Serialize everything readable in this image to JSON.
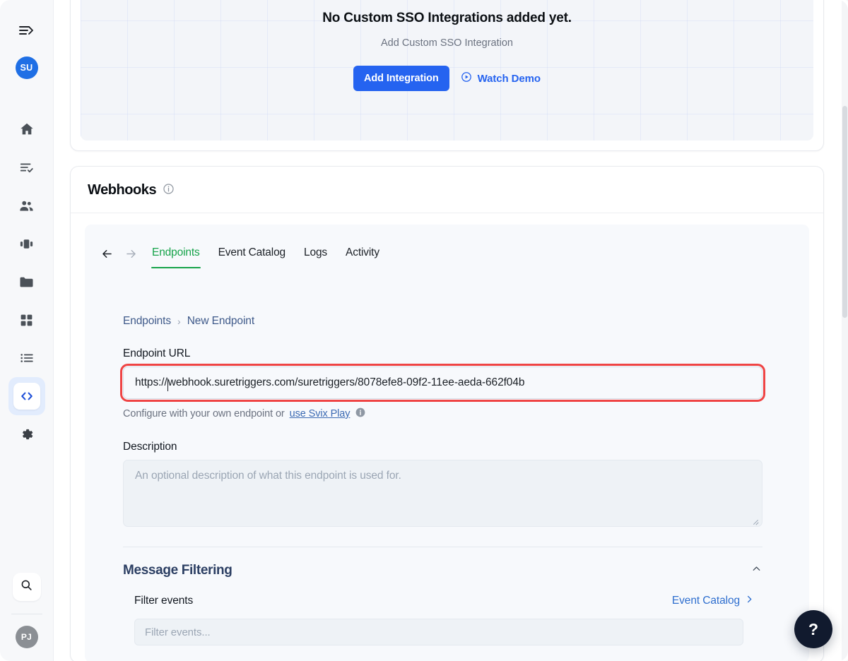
{
  "sidebar": {
    "toggle_label": "Collapse sidebar",
    "workspace_avatar": "SU",
    "user_avatar": "PJ",
    "items": [
      {
        "name": "home",
        "label": "Home"
      },
      {
        "name": "tasks",
        "label": "Tasks"
      },
      {
        "name": "contacts",
        "label": "Contacts"
      },
      {
        "name": "campaigns",
        "label": "Campaigns"
      },
      {
        "name": "files",
        "label": "Files"
      },
      {
        "name": "apps",
        "label": "Apps"
      },
      {
        "name": "lists",
        "label": "Lists"
      },
      {
        "name": "developer",
        "label": "Developer",
        "active": true
      },
      {
        "name": "settings",
        "label": "Settings"
      }
    ],
    "search_label": "Search"
  },
  "sso_card": {
    "title": "No Custom SSO Integrations added yet.",
    "subtitle": "Add Custom SSO Integration",
    "primary_button": "Add Integration",
    "demo_link": "Watch Demo"
  },
  "webhooks": {
    "title": "Webhooks",
    "info_icon": "info-circle-icon",
    "nav": {
      "back": "←",
      "forward": "→"
    },
    "tabs": [
      {
        "label": "Endpoints",
        "active": true
      },
      {
        "label": "Event Catalog",
        "active": false
      },
      {
        "label": "Logs",
        "active": false
      },
      {
        "label": "Activity",
        "active": false
      }
    ],
    "breadcrumb": {
      "root": "Endpoints",
      "separator": "›",
      "current": "New Endpoint"
    },
    "endpoint_url": {
      "label": "Endpoint URL",
      "value_prefix": "https://",
      "value_suffix": "webhook.suretriggers.com/suretriggers/8078efe8-09f2-11ee-aeda-662f04b",
      "value": "https://webhook.suretriggers.com/suretriggers/8078efe8-09f2-11ee-aeda-662f04b",
      "hint_prefix": "Configure with your own endpoint or ",
      "hint_link": "use Svix Play",
      "error_outline_color": "#ef4444"
    },
    "description": {
      "label": "Description",
      "placeholder": "An optional description of what this endpoint is used for."
    },
    "message_filtering": {
      "title": "Message Filtering",
      "collapse_icon": "chevron-up-icon",
      "filter_label": "Filter events",
      "catalog_link": "Event Catalog",
      "filter_placeholder": "Filter events..."
    }
  },
  "help": {
    "label": "?"
  },
  "colors": {
    "accent_blue": "#2563f0",
    "tab_green": "#16a34a",
    "error_red": "#ef4444",
    "link_blue": "#3b6ab3",
    "sidebar_bg": "#f7f8fa",
    "panel_bg": "#f7f9fc",
    "help_dark": "#111a2e"
  }
}
